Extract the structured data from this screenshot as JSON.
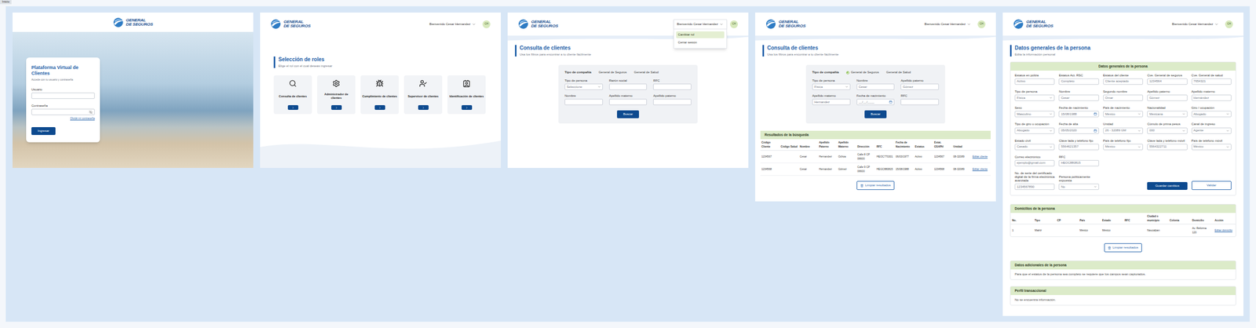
{
  "canvas_label": "Inicio",
  "brand": {
    "line1": "GENERAL",
    "line2": "DE SEGUROS"
  },
  "user": {
    "greeting": "Bienvenido Cesar Hernandez",
    "initials": "CH"
  },
  "login": {
    "title": "Plataforma Virtual de Clientes",
    "subtitle": "Accede con tu usuario y contraseña",
    "fields": [
      {
        "label": "Usuario",
        "value": "",
        "kind": "text"
      },
      {
        "label": "Contraseña",
        "value": "",
        "kind": "password"
      }
    ],
    "forgot": "Olvidé mi contraseña",
    "submit": "Ingresar"
  },
  "roles": {
    "menu_open": false,
    "title": "Selección de roles",
    "subtitle": "Elige el rol con el cual deseas ingresar",
    "cards": [
      {
        "label": "Consulta de clientes"
      },
      {
        "label": "Administrador de clientes"
      },
      {
        "label": "Cumplimiento de clientes"
      },
      {
        "label": "Supervisor de clientes"
      },
      {
        "label": "Identificación de clientes"
      }
    ]
  },
  "search": {
    "menu_open": true,
    "menu_items": [
      {
        "label": "Cambiar rol",
        "selected": true
      },
      {
        "label": "Cerrar sesión",
        "selected": false
      }
    ],
    "title": "Consulta de clientes",
    "subtitle": "Usa los filtros para encontrar a tu cliente fácilmente",
    "company_label": "Tipo de compañía",
    "companies": [
      {
        "label": "General de Seguros",
        "selected": false
      },
      {
        "label": "General de Salud",
        "selected": false
      }
    ],
    "fields": [
      {
        "label": "Tipo de persona",
        "value": "Seleccione",
        "kind": "select"
      },
      {
        "label": "Razón social",
        "value": "",
        "kind": "text"
      },
      {
        "label": "RFC",
        "value": "",
        "kind": "text"
      },
      {
        "label": "Nombre",
        "value": "",
        "kind": "text"
      },
      {
        "label": "Apellido materno",
        "value": "",
        "kind": "text"
      },
      {
        "label": "Apellido paterno",
        "value": "",
        "kind": "text"
      }
    ],
    "submit": "Buscar"
  },
  "search_results": {
    "menu_open": false,
    "title": "Consulta de clientes",
    "subtitle": "Usa los filtros para encontrar a tu cliente fácilmente",
    "company_label": "Tipo de compañía",
    "companies": [
      {
        "label": "General de Seguros",
        "selected": true
      },
      {
        "label": "General de Salud",
        "selected": false
      }
    ],
    "fields": [
      {
        "label": "Tipo de persona",
        "value": "Física",
        "kind": "select"
      },
      {
        "label": "Nombre",
        "value": "Cesar",
        "kind": "text"
      },
      {
        "label": "Apellido paterno",
        "value": "Gómez",
        "kind": "text"
      },
      {
        "label": "Apellido materno",
        "value": "Hernandez",
        "kind": "text"
      },
      {
        "label": "Fecha de nacimiento",
        "value": "__/__/____",
        "kind": "date"
      },
      {
        "label": "RFC",
        "value": "",
        "kind": "text"
      }
    ],
    "submit": "Buscar",
    "results": {
      "title": "Resultados de la búsqueda",
      "columns": [
        "Código Cliente",
        "Código Salud",
        "Nombre",
        "Apellido Paterno",
        "Apellido Materno",
        "Dirección",
        "RFC",
        "Fecha de Nacimiento",
        "Estatus",
        "Estat. GSAPH",
        "Unidad"
      ],
      "rows": [
        {
          "cells": [
            "1234567",
            "",
            "Cesar",
            "Hernandez",
            "Ochoa",
            "Calle 8 CP 06600",
            "HEOC770301",
            "06/03/1977",
            "Activo",
            "1234567",
            "08-32089"
          ],
          "action": "Editar cliente"
        },
        {
          "cells": [
            "1234568",
            "",
            "Cesar",
            "Hernandez",
            "Gómez",
            "Calle 9 CP 06600",
            "HEGC880815",
            "15/08/1988",
            "Activo",
            "1234568",
            "08-32089"
          ],
          "action": "Editar cliente"
        }
      ]
    },
    "clear": "Limpiar resultados"
  },
  "person": {
    "menu_open": false,
    "title": "Datos generales de la persona",
    "subtitle": "Edita la información personal",
    "section_title": "Datos generales de la persona",
    "field_rows": [
      [
        {
          "label": "Estatus en póliza",
          "value": "Activo",
          "kind": "text"
        },
        {
          "label": "Estatus Act. RSC",
          "value": "Completo",
          "kind": "text"
        },
        {
          "label": "Estatus del cliente",
          "value": "Cliente aceptado",
          "kind": "text"
        },
        {
          "label": "Cve. General de seguros",
          "value": "1234564",
          "kind": "text"
        },
        {
          "label": "Cve. General de salud",
          "value": "7654321",
          "kind": "text"
        }
      ],
      [
        {
          "label": "Tipo de persona",
          "value": "Física",
          "kind": "select"
        },
        {
          "label": "Nombre",
          "value": "Cesar",
          "kind": "text"
        },
        {
          "label": "Segundo nombre",
          "value": "Omar",
          "kind": "text"
        },
        {
          "label": "Apellido paterno",
          "value": "Gómez",
          "kind": "text"
        },
        {
          "label": "Apellido materno",
          "value": "Hernández",
          "kind": "text"
        }
      ],
      [
        {
          "label": "Sexo",
          "value": "Masculino",
          "kind": "select"
        },
        {
          "label": "Fecha de nacimiento",
          "value": "15/08/1988",
          "kind": "date"
        },
        {
          "label": "País de nacimiento",
          "value": "México",
          "kind": "select"
        },
        {
          "label": "Nacionalidad",
          "value": "Mexicana",
          "kind": "select"
        },
        {
          "label": "Giro / ocupación",
          "value": "Abogado",
          "kind": "select"
        }
      ],
      [
        {
          "label": "Tipo de giro u ocupación",
          "value": "Abogado",
          "kind": "select"
        },
        {
          "label": "Fecha de alta",
          "value": "05/05/2020",
          "kind": "date"
        },
        {
          "label": "Unidad",
          "value": "26 - 32089 GM",
          "kind": "select"
        },
        {
          "label": "Cúmulo de prima pesos",
          "value": "000",
          "kind": "select"
        },
        {
          "label": "Canal de ingreso",
          "value": "Agente",
          "kind": "select"
        }
      ],
      [
        {
          "label": "Estado civil",
          "value": "Casado",
          "kind": "select"
        },
        {
          "label": "Clave lada y teléfono fijo",
          "value": "5564621357",
          "kind": "text"
        },
        {
          "label": "País de teléfono fijo",
          "value": "México",
          "kind": "select"
        },
        {
          "label": "Clave lada y teléfono móvil",
          "value": "5564322711",
          "kind": "text"
        },
        {
          "label": "País de teléfono móvil",
          "value": "México",
          "kind": "select"
        }
      ],
      [
        {
          "label": "Correo electrónico",
          "value": "ejemplo@gmail.com",
          "kind": "text"
        },
        {
          "label": "RFC",
          "value": "HEOC880815",
          "kind": "text"
        }
      ],
      [
        {
          "label": "No. de serie del certificado digital de la firma electrónica avanzada",
          "value": "1234567890",
          "kind": "text"
        },
        {
          "label": "Persona políticamente expuesta",
          "value": "No",
          "kind": "select"
        }
      ]
    ],
    "actions": [
      {
        "label": "Guardar cambios",
        "kind": "primary"
      },
      {
        "label": "Validar",
        "kind": "secondary"
      }
    ],
    "addresses": {
      "title": "Domicilios de la persona",
      "columns": [
        "No.",
        "Tipo",
        "CP",
        "País",
        "Estado",
        "RFC",
        "Ciudad o municipio",
        "Colonia",
        "Domicilio",
        "Acción"
      ],
      "rows": [
        {
          "cells": [
            "1",
            "Matriz",
            "",
            "México",
            "México",
            "",
            "Naucalpan",
            "",
            "Av. Reforma 120"
          ],
          "action": "Editar domicilio"
        }
      ]
    },
    "clear": "Limpiar resultados",
    "additional": {
      "title": "Datos adicionales de la persona",
      "text": "Para que el estatus de la persona sea completo se requiere que los campos sean capturados."
    },
    "profile": {
      "title": "Perfil transaccional",
      "text": "No se encuentra información."
    }
  }
}
